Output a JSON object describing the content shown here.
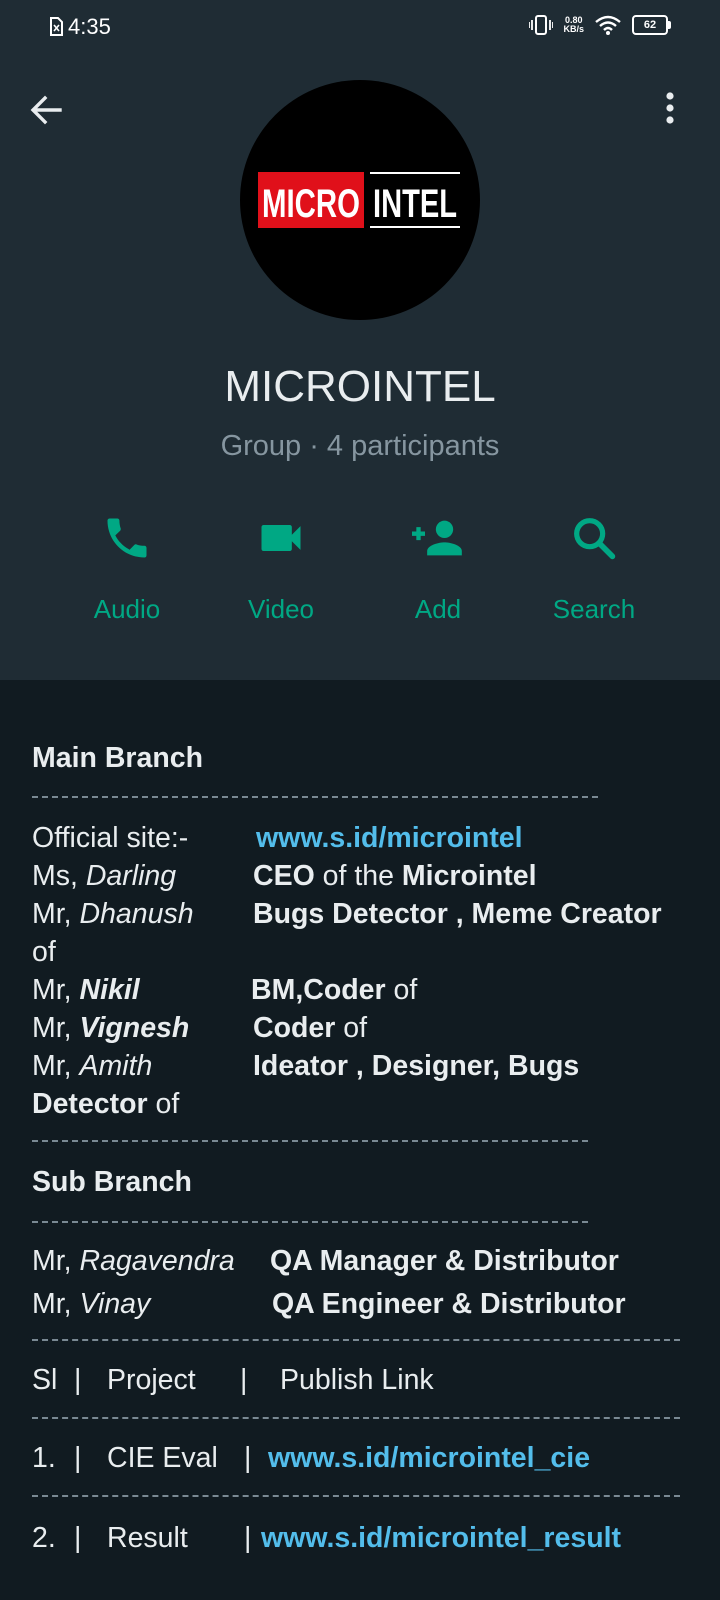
{
  "status_bar": {
    "time": "4:35",
    "net_speed_value": "0.80",
    "net_speed_unit": "KB/s",
    "battery": "62"
  },
  "header": {
    "logo_word_red": "MICRO",
    "logo_word_white": "INTEL",
    "group_name": "MICROINTEL",
    "subtitle": "Group · 4 participants",
    "actions": [
      {
        "label": "Audio",
        "icon": "phone-icon"
      },
      {
        "label": "Video",
        "icon": "videocam-icon"
      },
      {
        "label": "Add",
        "icon": "add-person-icon"
      },
      {
        "label": "Search",
        "icon": "search-icon"
      }
    ]
  },
  "description": {
    "main_branch_title": "Main Branch",
    "official_site_label": "Official site:-",
    "official_site_link": "www.s.id/microintel",
    "members": [
      {
        "prefix": "Ms, ",
        "name": "Darling",
        "role_bold": "CEO",
        "role_rest": " of the ",
        "role_bold2": "Microintel"
      },
      {
        "prefix": "Mr, ",
        "name": "Dhanush",
        "role_bold": "Bugs Detector , Meme Creator",
        "role_rest_line2": "of"
      },
      {
        "prefix": "Mr, ",
        "name": "Nikil",
        "role_bold": "BM,Coder",
        "role_rest": " of"
      },
      {
        "prefix": "Mr, ",
        "name": "Vignesh",
        "role_bold": "Coder",
        "role_rest": " of"
      },
      {
        "prefix": "Mr, ",
        "name": "Amith",
        "role_bold": "Ideator , Designer, Bugs",
        "role_bold_line2": "Detector",
        "role_rest_line2": " of"
      }
    ],
    "sub_branch_title": "Sub Branch",
    "sub_members": [
      {
        "prefix": "Mr, ",
        "name": "Ragavendra",
        "role": "QA Manager & Distributor"
      },
      {
        "prefix": "Mr, ",
        "name": "Vinay",
        "role": "QA Engineer & Distributor"
      }
    ],
    "table_header": {
      "sl": "Sl",
      "project": "Project",
      "link": "Publish Link",
      "sep": "|"
    },
    "table_rows": [
      {
        "sl": "1.",
        "project": "CIE Eval",
        "link": "www.s.id/microintel_cie"
      },
      {
        "sl": "2.",
        "project": "Result",
        "link": "www.s.id/microintel_result"
      }
    ]
  },
  "colors": {
    "accent": "#00A884",
    "link": "#53BDEB",
    "background": "#111B21",
    "header_background": "#1F2C34",
    "secondary_text": "#8696A0"
  }
}
